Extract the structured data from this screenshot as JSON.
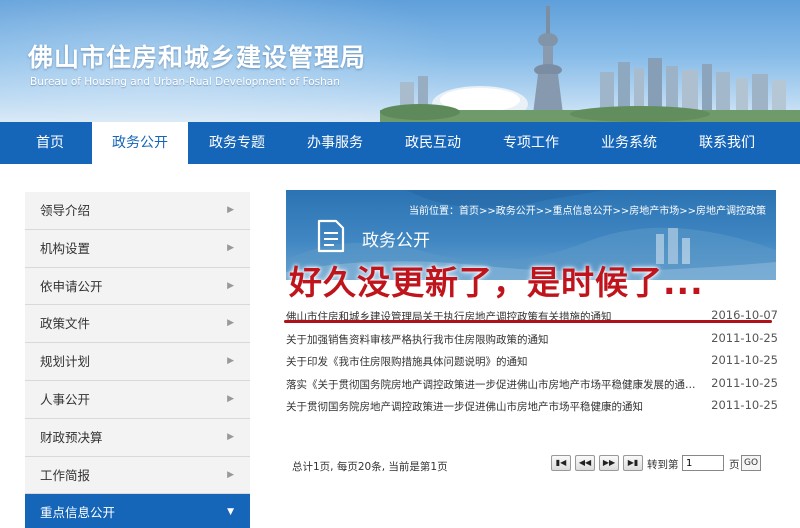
{
  "header": {
    "title": "佛山市住房和城乡建设管理局",
    "subtitle": "Bureau of Housing and Urban-Rual Development of Foshan"
  },
  "nav": {
    "items": [
      {
        "label": "首页"
      },
      {
        "label": "政务公开"
      },
      {
        "label": "政务专题"
      },
      {
        "label": "办事服务"
      },
      {
        "label": "政民互动"
      },
      {
        "label": "专项工作"
      },
      {
        "label": "业务系统"
      },
      {
        "label": "联系我们"
      }
    ],
    "active_index": 1
  },
  "sidebar": {
    "items": [
      {
        "label": "领导介绍"
      },
      {
        "label": "机构设置"
      },
      {
        "label": "依申请公开"
      },
      {
        "label": "政策文件"
      },
      {
        "label": "规划计划"
      },
      {
        "label": "人事公开"
      },
      {
        "label": "财政预决算"
      },
      {
        "label": "工作简报"
      },
      {
        "label": "重点信息公开"
      }
    ],
    "active_index": 8
  },
  "content": {
    "breadcrumb": "当前位置：首页>>政务公开>>重点信息公开>>房地产市场>>房地产调控政策",
    "section_title": "政务公开",
    "overlay_annotation": "好久没更新了，是时候了...",
    "news": [
      {
        "title": "佛山市住房和城乡建设管理局关于执行房地产调控政策有关措施的通知",
        "date": "2016-10-07"
      },
      {
        "title": "关于加强销售资料审核严格执行我市住房限购政策的通知",
        "date": "2011-10-25"
      },
      {
        "title": "关于印发《我市住房限购措施具体问题说明》的通知",
        "date": "2011-10-25"
      },
      {
        "title": "落实《关于贯彻国务院房地产调控政策进一步促进佛山市房地产市场平稳健康发展的通知》",
        "date": "2011-10-25"
      },
      {
        "title": "关于贯彻国务院房地产调控政策进一步促进佛山市房地产市场平稳健康的通知",
        "date": "2011-10-25"
      }
    ]
  },
  "pager": {
    "summary": "总计1页, 每页20条, 当前是第1页",
    "goto_label": "转到第",
    "goto_value": "1",
    "unit": "页",
    "go_label": "GO",
    "buttons": [
      "first-page-icon",
      "prev-page-icon",
      "next-page-icon",
      "last-page-icon"
    ]
  },
  "colors": {
    "nav_blue": "#1565b8",
    "annotation_red": "#c0141c"
  }
}
